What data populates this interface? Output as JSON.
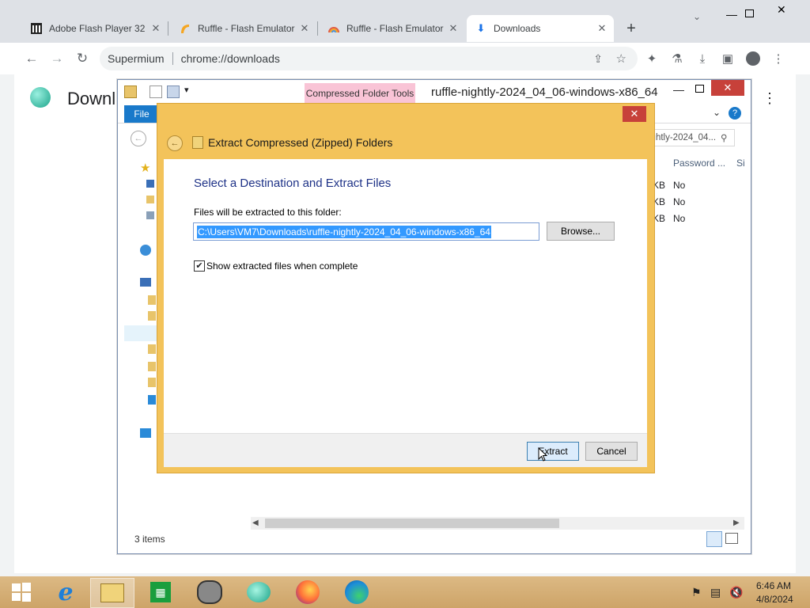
{
  "browser": {
    "tabs": [
      {
        "title": "Adobe Flash Player 32",
        "icon": "museum-icon",
        "active": false
      },
      {
        "title": "Ruffle - Flash Emulator",
        "icon": "ruffle-icon",
        "active": false
      },
      {
        "title": "Ruffle - Flash Emulator",
        "icon": "ruffle-rainbow-icon",
        "active": false
      },
      {
        "title": "Downloads",
        "icon": "download-icon",
        "active": true
      }
    ],
    "omnibox": {
      "site": "Supermium",
      "url": "chrome://downloads"
    },
    "page_heading": "Downl"
  },
  "explorer": {
    "title": "ruffle-nightly-2024_04_06-windows-x86_64",
    "context_tab": "Compressed Folder Tools",
    "file_tab": "File",
    "search_path": "ightly-2024_04...",
    "columns": [
      "Password ...",
      "Si"
    ],
    "rows": [
      {
        "size_tail": "KB",
        "password": "No"
      },
      {
        "size_tail": "KB",
        "password": "No"
      },
      {
        "size_tail": "KB",
        "password": "No"
      }
    ],
    "status": "3 items"
  },
  "dialog": {
    "title": "Extract Compressed (Zipped) Folders",
    "heading": "Select a Destination and Extract Files",
    "folder_label": "Files will be extracted to this folder:",
    "path_value": "C:\\Users\\VM7\\Downloads\\ruffle-nightly-2024_04_06-windows-x86_64",
    "browse_label": "Browse...",
    "checkbox_label": "Show extracted files when complete",
    "checkbox_checked": true,
    "extract_label": "Extract",
    "cancel_label": "Cancel"
  },
  "taskbar": {
    "time": "6:46 AM",
    "date": "4/8/2024"
  },
  "colors": {
    "dialog_frame": "#f3c35a",
    "title_blue": "#1e3287",
    "file_tab": "#1979ca",
    "close_red": "#c7413a"
  }
}
